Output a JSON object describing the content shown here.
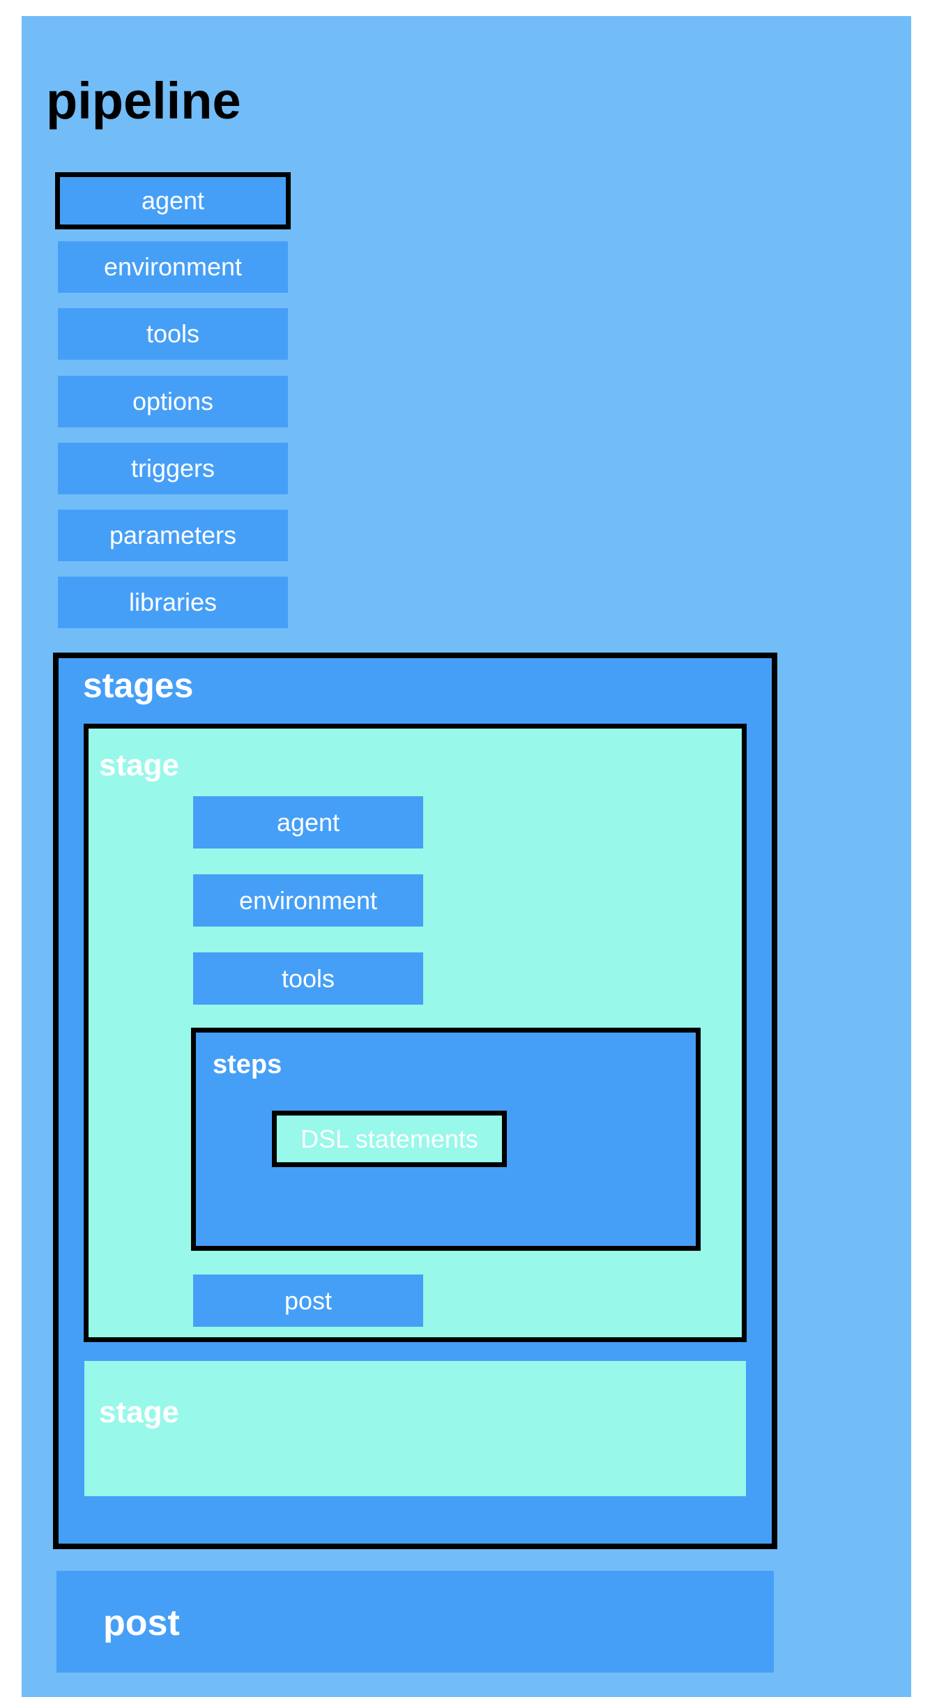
{
  "colors": {
    "outer": "#72BDF8",
    "block": "#469FF7",
    "stage": "#98F8EA",
    "border": "#000000"
  },
  "pipeline": {
    "title": "pipeline",
    "directives": [
      "agent",
      "environment",
      "tools",
      "options",
      "triggers",
      "parameters",
      "libraries"
    ],
    "stages": {
      "label": "stages",
      "stage1": {
        "label": "stage",
        "directives": [
          "agent",
          "environment",
          "tools"
        ],
        "steps": {
          "label": "steps",
          "content": "DSL statements"
        },
        "post": "post"
      },
      "stage2": {
        "label": "stage"
      }
    },
    "post": "post"
  }
}
